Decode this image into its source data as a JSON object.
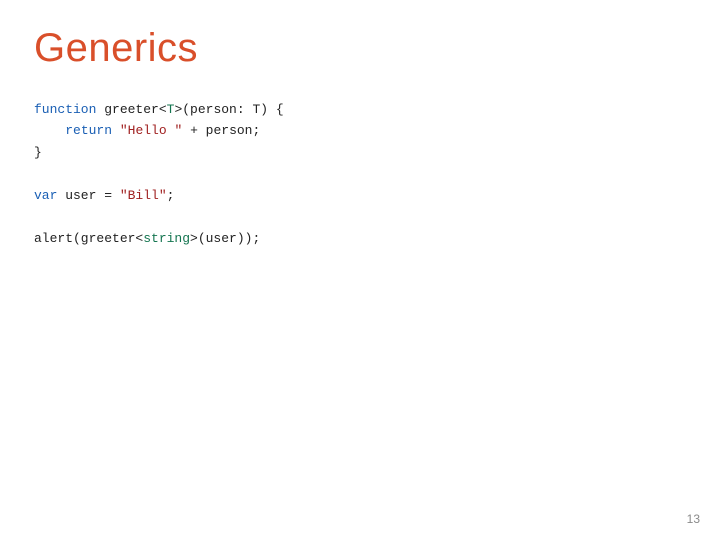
{
  "title": "Generics",
  "code": {
    "l1": {
      "kw": "function",
      "name": " greeter<",
      "gen": "T",
      "tail": ">(person: T) {"
    },
    "l2": {
      "indent": "    ",
      "kw": "return",
      "sp": " ",
      "str": "\"Hello \"",
      "tail": " + person;"
    },
    "l3": {
      "text": "}"
    },
    "l4": {
      "kw": "var",
      "tail": " user = ",
      "str": "\"Bill\"",
      "semi": ";"
    },
    "l5": {
      "head": "alert(greeter<",
      "type": "string",
      "tail": ">(user));"
    }
  },
  "page_number": "13"
}
